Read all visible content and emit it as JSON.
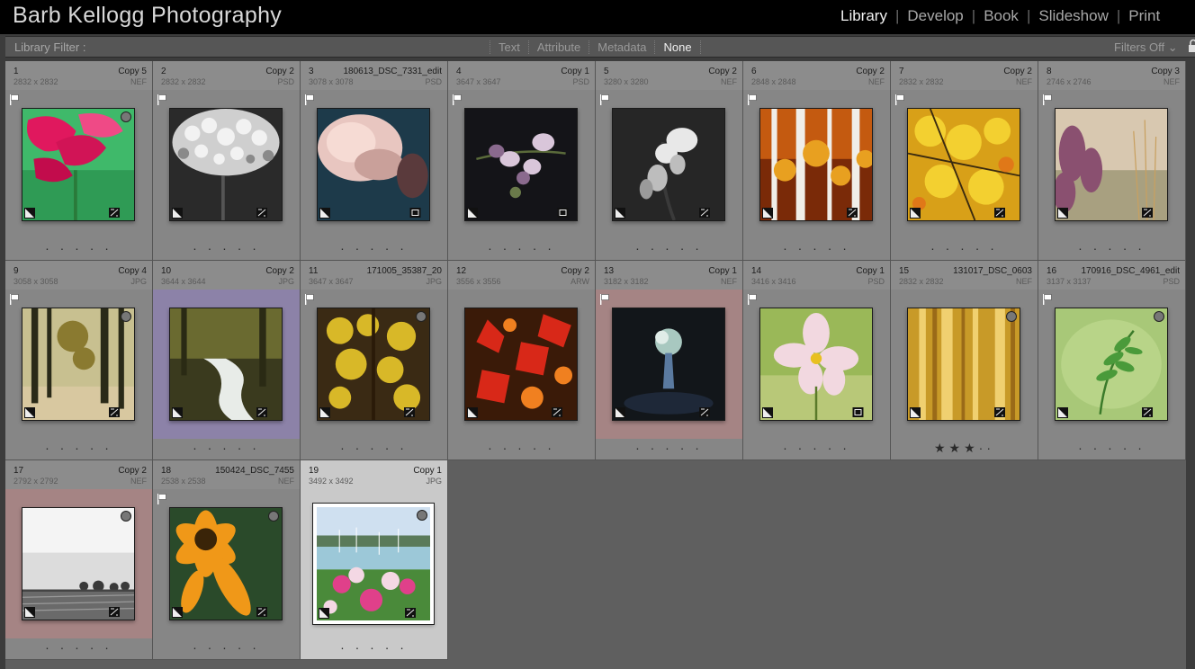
{
  "identity_plate": "Barb Kellogg Photography",
  "modules": [
    {
      "label": "Library",
      "active": true
    },
    {
      "label": "Develop",
      "active": false
    },
    {
      "label": "Book",
      "active": false
    },
    {
      "label": "Slideshow",
      "active": false
    },
    {
      "label": "Print",
      "active": false
    }
  ],
  "module_separator": "|",
  "filter_bar": {
    "title": "Library Filter :",
    "options": [
      {
        "label": "Text",
        "active": false
      },
      {
        "label": "Attribute",
        "active": false
      },
      {
        "label": "Metadata",
        "active": false
      },
      {
        "label": "None",
        "active": true
      }
    ],
    "filters_state": "Filters Off ⌄"
  },
  "photos": [
    {
      "index": "1",
      "copy": "Copy 5",
      "dims": "2832 x 2832",
      "type": "NEF",
      "flag": true,
      "circle": true,
      "stars": "· · · · ·",
      "label_color": "",
      "selected": false,
      "art": "red-petals",
      "badges": [
        "tag",
        "crop",
        "adjust"
      ]
    },
    {
      "index": "2",
      "copy": "Copy 2",
      "dims": "2832 x 2832",
      "type": "PSD",
      "flag": true,
      "circle": false,
      "stars": "· · · · ·",
      "label_color": "",
      "selected": false,
      "art": "mono-hydrangea",
      "badges": [
        "tag",
        "crop",
        "adjust"
      ]
    },
    {
      "index": "3",
      "copy": "180613_DSC_7331_edit",
      "dims": "3078 x 3078",
      "type": "PSD",
      "flag": true,
      "circle": false,
      "stars": "· · · · ·",
      "label_color": "",
      "selected": false,
      "art": "pink-bloom",
      "badges": [
        "tag",
        "crop"
      ]
    },
    {
      "index": "4",
      "copy": "Copy 1",
      "dims": "3647 x 3647",
      "type": "PSD",
      "flag": true,
      "circle": false,
      "stars": "· · · · ·",
      "label_color": "",
      "selected": false,
      "art": "dark-orchid",
      "badges": [
        "tag",
        "crop"
      ]
    },
    {
      "index": "5",
      "copy": "Copy 2",
      "dims": "3280 x 3280",
      "type": "NEF",
      "flag": true,
      "circle": false,
      "stars": "· · · · ·",
      "label_color": "",
      "selected": false,
      "art": "white-orchid",
      "badges": [
        "tag",
        "crop",
        "adjust"
      ]
    },
    {
      "index": "6",
      "copy": "Copy 2",
      "dims": "2848 x 2848",
      "type": "NEF",
      "flag": true,
      "circle": false,
      "stars": "· · · · ·",
      "label_color": "",
      "selected": false,
      "art": "birch-autumn",
      "badges": [
        "tag",
        "crop",
        "adjust"
      ]
    },
    {
      "index": "7",
      "copy": "Copy 2",
      "dims": "2832 x 2832",
      "type": "NEF",
      "flag": true,
      "circle": false,
      "stars": "· · · · ·",
      "label_color": "",
      "selected": false,
      "art": "yellow-leaves",
      "badges": [
        "tag",
        "crop",
        "adjust"
      ]
    },
    {
      "index": "8",
      "copy": "Copy 3",
      "dims": "2746 x 2746",
      "type": "NEF",
      "flag": true,
      "circle": false,
      "stars": "· · · · ·",
      "label_color": "",
      "selected": false,
      "art": "heather",
      "badges": [
        "tag",
        "crop",
        "adjust"
      ]
    },
    {
      "index": "9",
      "copy": "Copy 4",
      "dims": "3058 x 3058",
      "type": "JPG",
      "flag": true,
      "circle": true,
      "stars": "· · · · ·",
      "label_color": "",
      "selected": false,
      "art": "forest-path",
      "badges": [
        "tag",
        "crop",
        "adjust"
      ]
    },
    {
      "index": "10",
      "copy": "Copy 2",
      "dims": "3644 x 3644",
      "type": "JPG",
      "flag": false,
      "circle": false,
      "stars": "· · · · ·",
      "label_color": "#8c82a8",
      "selected": false,
      "art": "forest-stream",
      "badges": [
        "tag",
        "crop",
        "adjust"
      ]
    },
    {
      "index": "11",
      "copy": "171005_35387_20",
      "dims": "3647 x 3647",
      "type": "JPG",
      "flag": true,
      "circle": true,
      "stars": "· · · · ·",
      "label_color": "",
      "selected": false,
      "art": "yellow-tree",
      "badges": [
        "tag",
        "crop",
        "adjust"
      ]
    },
    {
      "index": "12",
      "copy": "Copy 2",
      "dims": "3556 x 3556",
      "type": "ARW",
      "flag": false,
      "circle": false,
      "stars": "· · · · ·",
      "label_color": "",
      "selected": false,
      "art": "red-maple",
      "badges": [
        "tag",
        "crop",
        "adjust"
      ]
    },
    {
      "index": "13",
      "copy": "Copy 1",
      "dims": "3182 x 3182",
      "type": "NEF",
      "flag": true,
      "circle": false,
      "stars": "· · · · ·",
      "label_color": "#a58484",
      "selected": false,
      "art": "vase-dark",
      "badges": [
        "tag",
        "crop",
        "adjust"
      ]
    },
    {
      "index": "14",
      "copy": "Copy 1",
      "dims": "3416 x 3416",
      "type": "PSD",
      "flag": true,
      "circle": false,
      "stars": "· · · · ·",
      "label_color": "",
      "selected": false,
      "art": "cosmos-pink",
      "badges": [
        "tag",
        "crop"
      ]
    },
    {
      "index": "15",
      "copy": "131017_DSC_0603",
      "dims": "2832 x 2832",
      "type": "NEF",
      "flag": false,
      "circle": true,
      "stars": "★★★··",
      "label_color": "",
      "selected": false,
      "art": "gold-blur",
      "badges": [
        "tag",
        "crop",
        "adjust"
      ]
    },
    {
      "index": "16",
      "copy": "170916_DSC_4961_edit",
      "dims": "3137 x 3137",
      "type": "PSD",
      "flag": true,
      "circle": true,
      "stars": "· · · · ·",
      "label_color": "",
      "selected": false,
      "art": "green-fern",
      "badges": [
        "tag",
        "crop",
        "adjust"
      ]
    },
    {
      "index": "17",
      "copy": "Copy 2",
      "dims": "2792 x 2792",
      "type": "NEF",
      "flag": false,
      "circle": true,
      "stars": "· · · · ·",
      "label_color": "#a58484",
      "selected": false,
      "art": "bw-field",
      "badges": [
        "tag",
        "crop",
        "adjust"
      ]
    },
    {
      "index": "18",
      "copy": "150424_DSC_7455",
      "dims": "2538 x 2538",
      "type": "NEF",
      "flag": true,
      "circle": true,
      "stars": "· · · · ·",
      "label_color": "",
      "selected": false,
      "art": "orange-gerbera",
      "badges": [
        "tag",
        "crop",
        "adjust"
      ]
    },
    {
      "index": "19",
      "copy": "Copy 1",
      "dims": "3492 x 3492",
      "type": "JPG",
      "flag": false,
      "circle": true,
      "stars": "· · · · ·",
      "label_color": "",
      "selected": true,
      "art": "harbor-cosmos",
      "badges": [
        "tag",
        "crop",
        "adjust"
      ]
    }
  ]
}
